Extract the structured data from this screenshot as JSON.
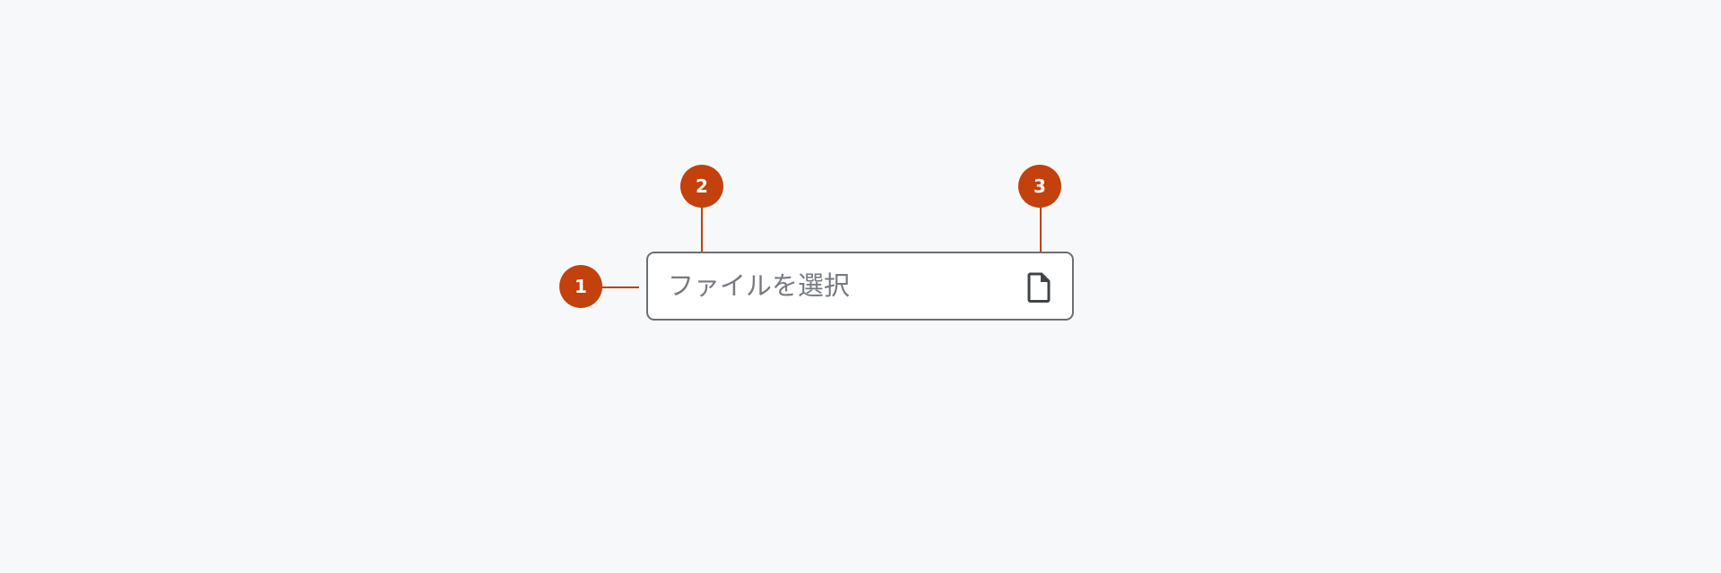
{
  "file_input": {
    "placeholder": "ファイルを選択",
    "icon": "file-icon"
  },
  "annotations": [
    {
      "number": "1",
      "target": "container"
    },
    {
      "number": "2",
      "target": "placeholder"
    },
    {
      "number": "3",
      "target": "icon"
    }
  ],
  "colors": {
    "background": "#f7f8fa",
    "marker": "#c2410c",
    "border": "#6b6e73",
    "placeholder_text": "#767a80",
    "icon": "#3f4449"
  }
}
